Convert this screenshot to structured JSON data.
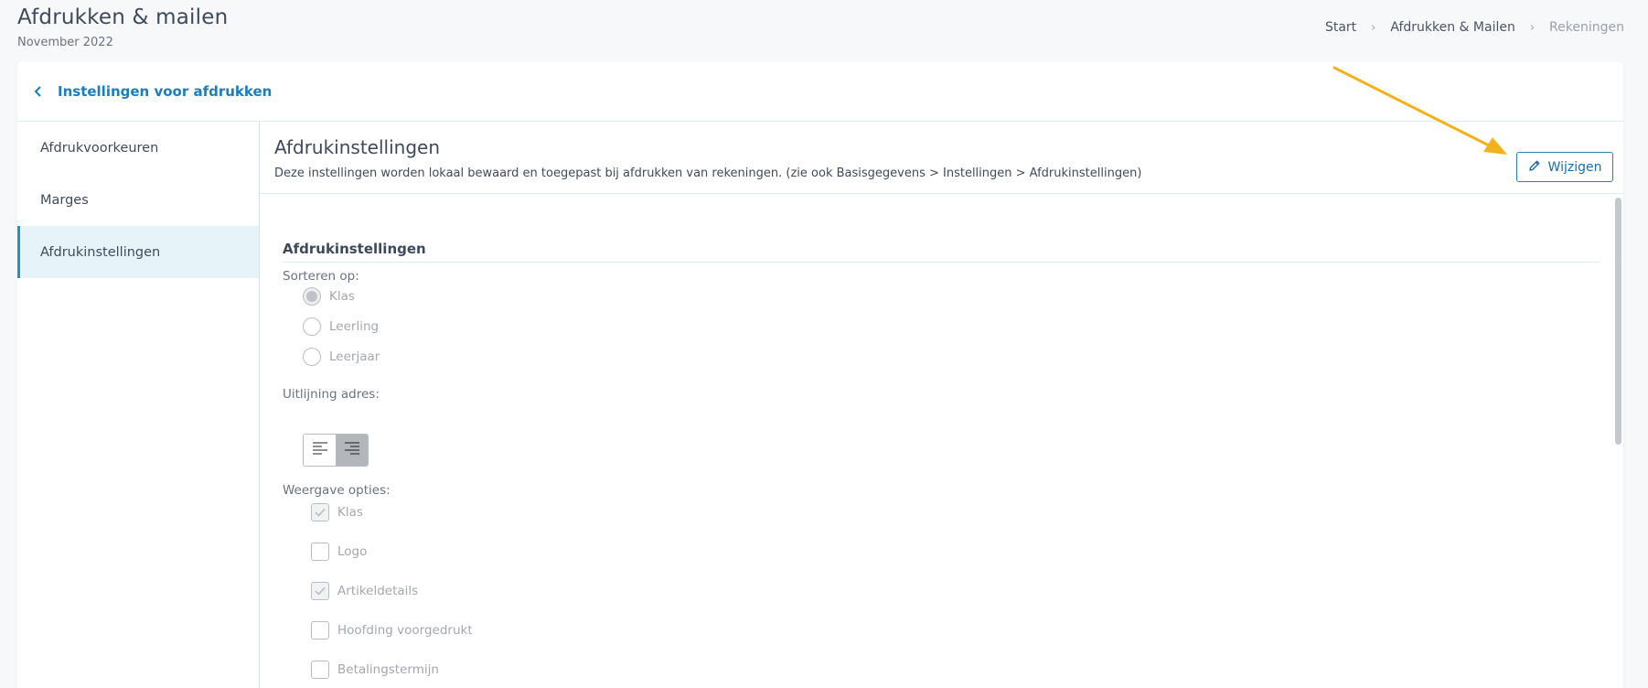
{
  "page": {
    "title": "Afdrukken & mailen",
    "subtitle": "November 2022"
  },
  "breadcrumb": {
    "items": [
      "Start",
      "Afdrukken & Mailen",
      "Rekeningen"
    ]
  },
  "card": {
    "back_label": "Instellingen voor afdrukken"
  },
  "sidebar": {
    "items": [
      {
        "label": "Afdrukvoorkeuren",
        "active": false
      },
      {
        "label": "Marges",
        "active": false
      },
      {
        "label": "Afdrukinstellingen",
        "active": true
      }
    ]
  },
  "content": {
    "title": "Afdrukinstellingen",
    "description": "Deze instellingen worden lokaal bewaard en toegepast bij afdrukken van rekeningen. (zie ook Basisgegevens > Instellingen > Afdrukinstellingen)",
    "edit_label": "Wijzigen"
  },
  "form": {
    "section_title": "Afdrukinstellingen",
    "sort_label": "Sorteren op:",
    "sort_options": [
      {
        "label": "Klas",
        "checked": true
      },
      {
        "label": "Leerling",
        "checked": false
      },
      {
        "label": "Leerjaar",
        "checked": false
      }
    ],
    "align_label": "Uitlijning adres:",
    "align_selected": "right",
    "display_label": "Weergave opties:",
    "display_options": [
      {
        "label": "Klas",
        "checked": true
      },
      {
        "label": "Logo",
        "checked": false
      },
      {
        "label": "Artikeldetails",
        "checked": true
      },
      {
        "label": "Hoofding voorgedrukt",
        "checked": false
      },
      {
        "label": "Betalingstermijn",
        "checked": false
      }
    ]
  },
  "colors": {
    "accent": "#1d7db7",
    "annotation_arrow": "#f2b21c",
    "active_bg": "#e6f3f8"
  },
  "icons": {
    "back": "chevron-left-icon",
    "edit": "pencil-icon",
    "align_left": "align-left-icon",
    "align_right": "align-right-icon"
  }
}
